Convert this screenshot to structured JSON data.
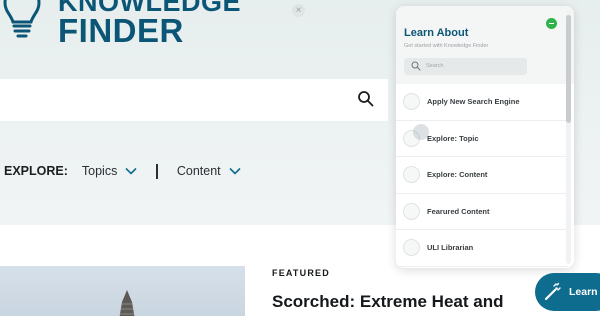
{
  "header": {
    "logo_line1": "KNOWLEDGE",
    "logo_line2": "FINDER",
    "close_glyph": "×"
  },
  "explore": {
    "label": "EXPLORE:",
    "items": [
      {
        "label": "Topics",
        "icon": "chevron-down-icon"
      },
      {
        "label": "Content",
        "icon": "chevron-down-icon"
      }
    ]
  },
  "search": {
    "icon": "search-icon"
  },
  "feature": {
    "kicker": "FEATURED",
    "title": "Scorched: Extreme Heat and"
  },
  "panel": {
    "title": "Learn About",
    "subtitle": "Get started with Knowledge Finder",
    "search_placeholder": "Search",
    "items": [
      {
        "label": "Apply New Search Engine"
      },
      {
        "label": "Explore: Topic"
      },
      {
        "label": "Explore: Content"
      },
      {
        "label": "Fearured Content"
      },
      {
        "label": "ULI Librarian"
      }
    ]
  },
  "learn_button": {
    "label": "Learn",
    "icon": "magic-wand-icon"
  },
  "colors": {
    "brand": "#0b5576",
    "button": "#0e6c8e",
    "minimize": "#2fb34a",
    "hero_bg": "#e7eeee"
  }
}
